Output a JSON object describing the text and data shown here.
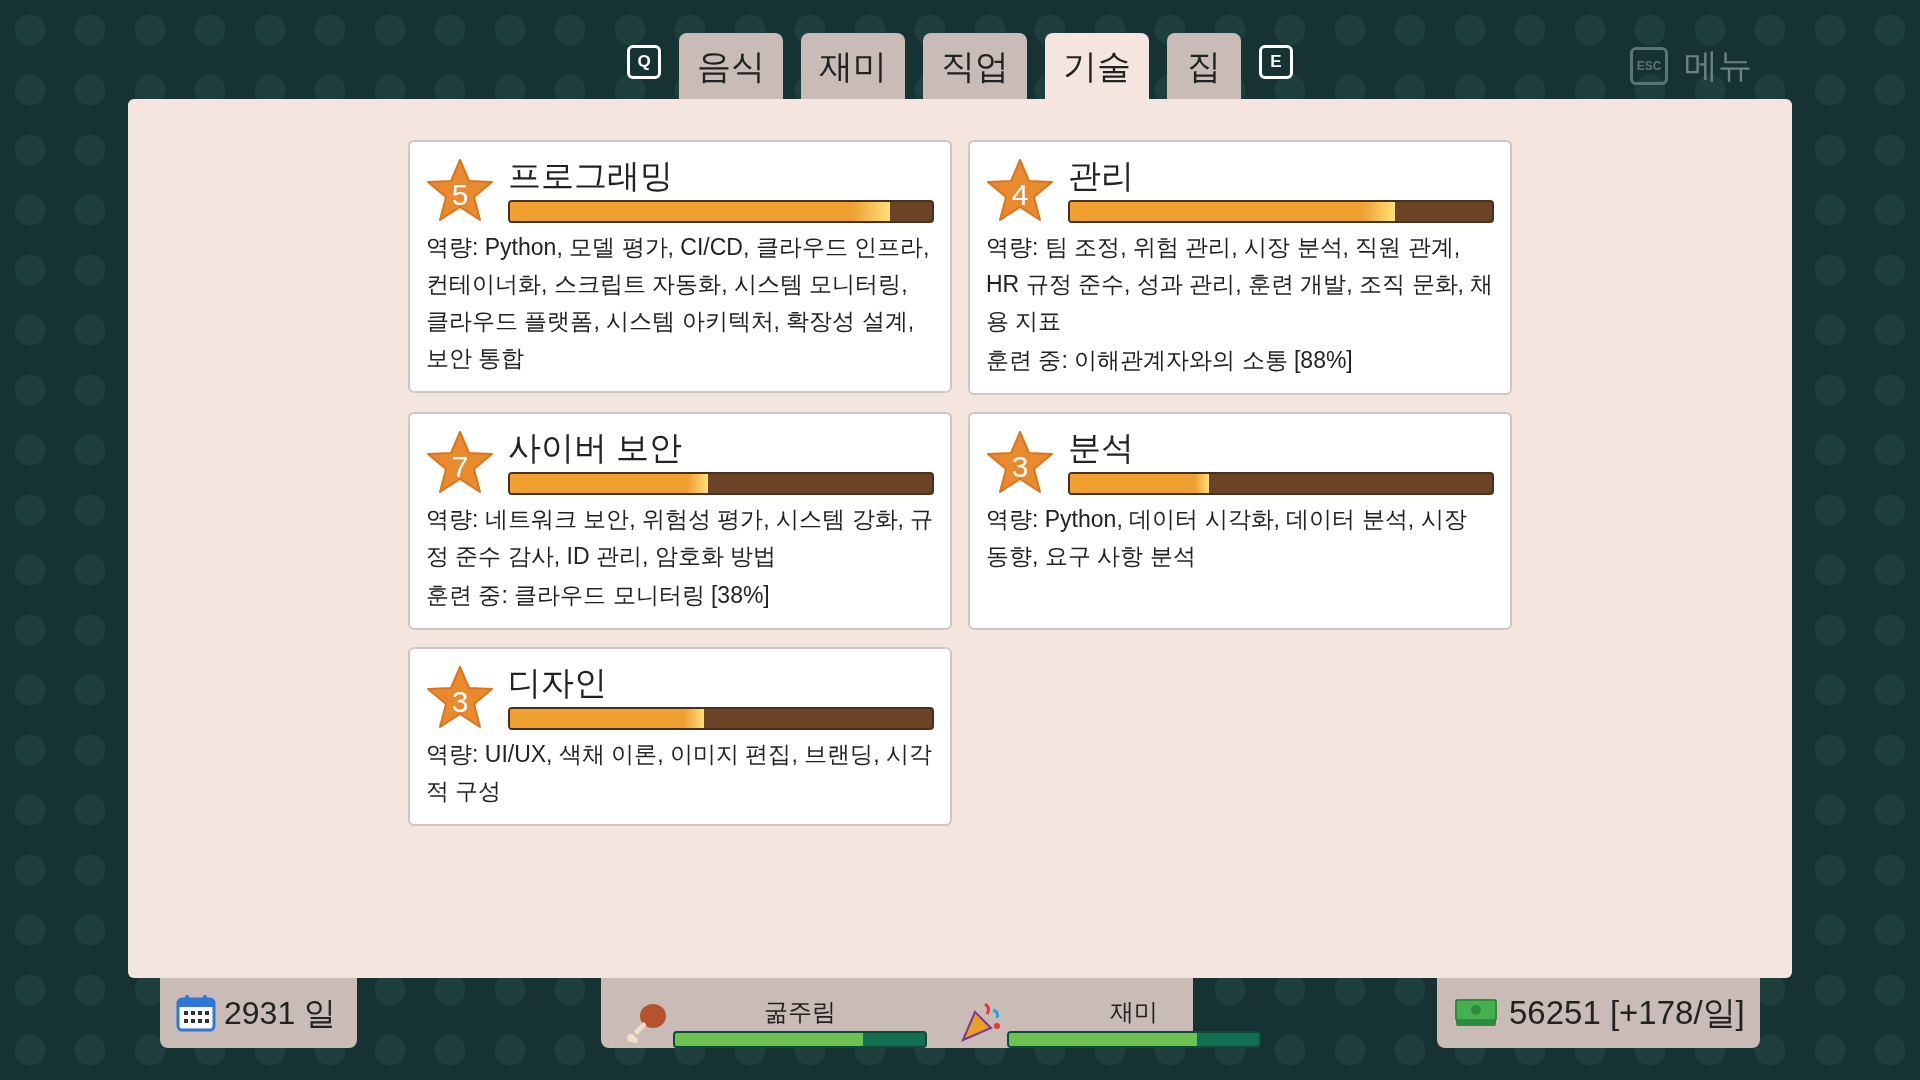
{
  "top_bar": {
    "prev_key": "Q",
    "next_key": "E",
    "tabs": [
      {
        "label": "음식",
        "selected": false
      },
      {
        "label": "재미",
        "selected": false
      },
      {
        "label": "직업",
        "selected": false
      },
      {
        "label": "기술",
        "selected": true
      },
      {
        "label": "집",
        "selected": false
      }
    ],
    "menu_key": "ESC",
    "menu_label": "메뉴"
  },
  "skills": [
    {
      "rank": "5",
      "name": "프로그래밍",
      "level": 0.9,
      "description": "역량: Python, 모델 평가, CI/CD, 클라우드 인프라, 컨테이너화, 스크립트 자동화, 시스템 모니터링, 클라우드 플랫폼, 시스템 아키텍처, 확장성 설계, 보안 통합"
    },
    {
      "rank": "4",
      "name": "관리",
      "level": 0.77,
      "description": "역량: 팀 조정, 위험 관리, 시장 분석, 직원 관계, HR 규정 준수, 성과 관리, 훈련 개발, 조직 문화, 채용 지표",
      "training": "훈련 중: 이해관계자와의 소통 [88%]"
    },
    {
      "rank": "7",
      "name": "사이버 보안",
      "level": 0.47,
      "description": "역량: 네트워크 보안, 위험성 평가, 시스템 강화, 규정 준수 감사, ID 관리, 암호화 방법",
      "training": "훈련 중: 클라우드 모니터링 [38%]"
    },
    {
      "rank": "3",
      "name": "분석",
      "level": 0.33,
      "description": "역량: Python, 데이터 시각화, 데이터 분석, 시장 동향, 요구 사항 분석"
    },
    {
      "rank": "3",
      "name": "디자인",
      "level": 0.46,
      "description": "역량: UI/UX, 색채 이론, 이미지 편집, 브랜딩, 시각적 구성"
    }
  ],
  "status_bar": {
    "day": "2931 일",
    "needs": [
      {
        "label": "굶주림",
        "kind": "food",
        "level": 0.75
      },
      {
        "label": "재미",
        "kind": "fun",
        "level": 0.75
      }
    ],
    "money": "56251 [+178/일]"
  }
}
